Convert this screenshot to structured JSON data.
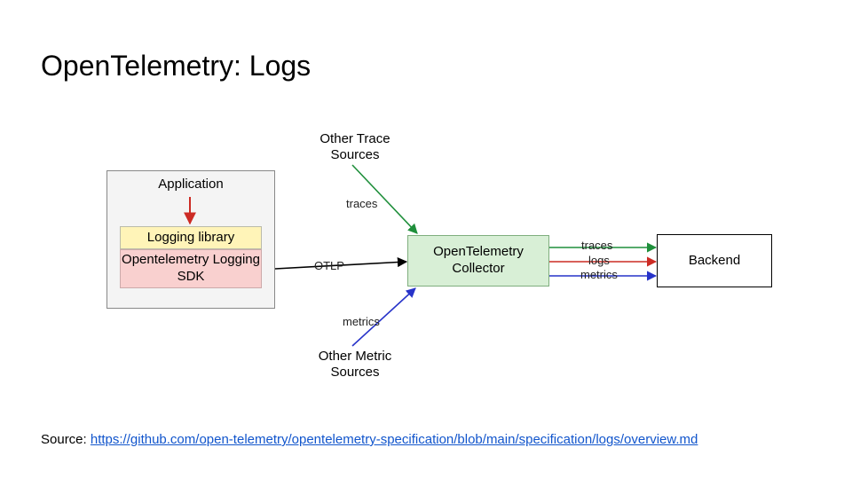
{
  "title": "OpenTelemetry: Logs",
  "application": {
    "label": "Application",
    "logging_library": "Logging library",
    "otel_sdk": "Opentelemetry Logging SDK"
  },
  "collector": "OpenTelemetry Collector",
  "backend": "Backend",
  "other_trace_sources": "Other Trace Sources",
  "other_metric_sources": "Other Metric Sources",
  "edges": {
    "otlp": "OTLP",
    "traces_in": "traces",
    "metrics_in": "metrics",
    "traces_out": "traces",
    "logs_out": "logs",
    "metrics_out": "metrics"
  },
  "source": {
    "prefix": "Source: ",
    "url": "https://github.com/open-telemetry/opentelemetry-specification/blob/main/specification/logs/overview.md"
  },
  "colors": {
    "green": "#1f8f3b",
    "red": "#cc2b24",
    "blue": "#2733c9",
    "black": "#000000"
  }
}
